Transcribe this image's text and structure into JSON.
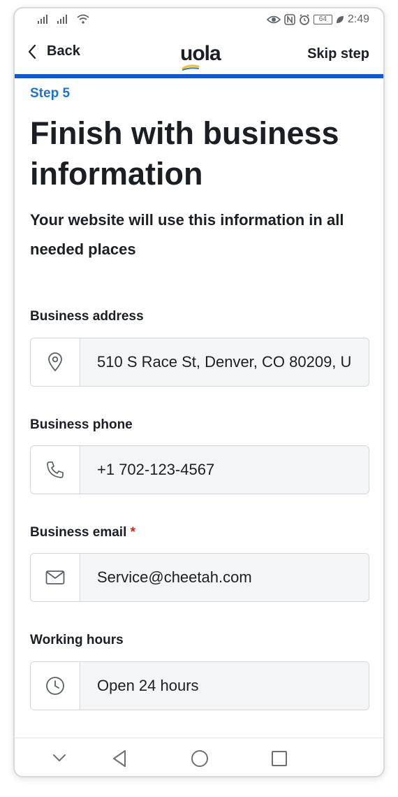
{
  "status_bar": {
    "time": "2:49",
    "battery": "64",
    "icons_left": [
      "signal-icon",
      "signal-icon",
      "wifi-icon"
    ],
    "icons_right": [
      "eye-icon",
      "nfc-icon",
      "alarm-icon",
      "battery-icon",
      "leaf-icon"
    ]
  },
  "header": {
    "back_label": "Back",
    "logo_text": "uola",
    "skip_label": "Skip step",
    "progress_color": "#0a5bd8"
  },
  "main": {
    "step": "Step 5",
    "title": "Finish with business information",
    "subtitle": "Your website will use this information in all needed places",
    "fields": [
      {
        "label": "Business address",
        "value": "510 S Race St, Denver, CO 80209, U",
        "icon": "location-pin-icon",
        "required": false
      },
      {
        "label": "Business phone",
        "value": "+1 702-123-4567",
        "icon": "phone-icon",
        "required": false
      },
      {
        "label": "Business email",
        "value": "Service@cheetah.com",
        "icon": "envelope-icon",
        "required": true,
        "required_mark": "*"
      },
      {
        "label": "Working hours",
        "value": "Open 24 hours",
        "icon": "clock-icon",
        "required": false
      }
    ]
  },
  "colors": {
    "accent": "#1e73d2",
    "required": "#c62828",
    "field_bg": "#f4f5f7"
  },
  "nav_bar": {
    "buttons": [
      "chevron-down-icon",
      "back-triangle-icon",
      "home-circle-icon",
      "recents-square-icon"
    ]
  }
}
